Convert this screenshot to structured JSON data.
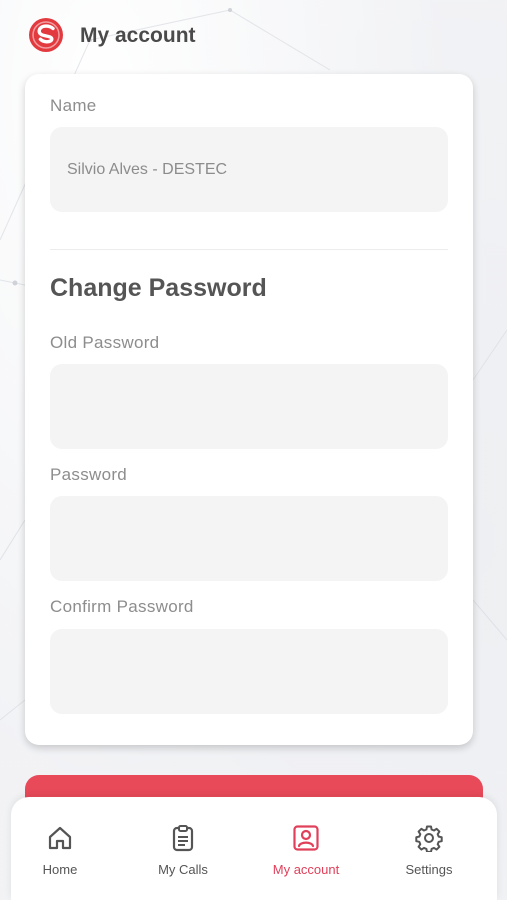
{
  "header": {
    "title": "My account",
    "logo_icon": "brand-s-logo-icon"
  },
  "form": {
    "name_label": "Name",
    "name_value": "Silvio Alves - DESTEC",
    "section_title": "Change Password",
    "old_password_label": "Old Password",
    "old_password_value": "",
    "password_label": "Password",
    "password_value": "",
    "confirm_password_label": "Confirm Password",
    "confirm_password_value": ""
  },
  "nav": {
    "items": [
      {
        "label": "Home",
        "icon": "home-icon",
        "active": false
      },
      {
        "label": "My Calls",
        "icon": "clipboard-icon",
        "active": false
      },
      {
        "label": "My account",
        "icon": "user-icon",
        "active": true
      },
      {
        "label": "Settings",
        "icon": "gear-icon",
        "active": false
      }
    ]
  },
  "colors": {
    "accent": "#e84a5a",
    "active_nav": "#e0405a",
    "field_bg": "#f4f4f4",
    "label": "#8d8d8d"
  }
}
